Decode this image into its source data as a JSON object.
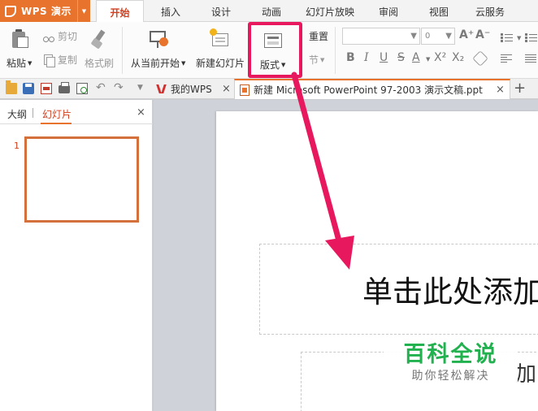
{
  "app": {
    "name": "WPS 演示"
  },
  "menu_tabs": [
    "开始",
    "插入",
    "设计",
    "动画",
    "幻灯片放映",
    "审阅",
    "视图",
    "云服务"
  ],
  "ribbon": {
    "paste": "粘贴",
    "cut": "剪切",
    "copy": "复制",
    "format_painter": "格式刷",
    "from_current": "从当前开始",
    "new_slide": "新建幻灯片",
    "layout": "版式",
    "reset": "重置",
    "section": "节",
    "font_size": "0",
    "font_glyphs": {
      "bold": "B",
      "italic": "I",
      "underline": "U",
      "strike": "S",
      "color": "A",
      "superscript": "X²",
      "subscript": "X₂",
      "grow": "A⁺",
      "shrink": "A⁻"
    }
  },
  "doc_tabs": [
    {
      "label": "我的WPS"
    },
    {
      "label": "新建 Microsoft PowerPoint 97-2003 演示文稿.ppt"
    }
  ],
  "panel": {
    "tabs": [
      "大纲",
      "幻灯片"
    ],
    "slide_number": "1"
  },
  "slide": {
    "title_placeholder": "单击此处添加",
    "subtitle_fragment": "加"
  },
  "watermark": {
    "title": "百科全说",
    "subtitle": "助你轻松解决"
  },
  "colors": {
    "accent": "#e8732c",
    "active_tab_text": "#d1401f",
    "highlight": "#e8185f",
    "watermark_green": "#21b14e"
  }
}
